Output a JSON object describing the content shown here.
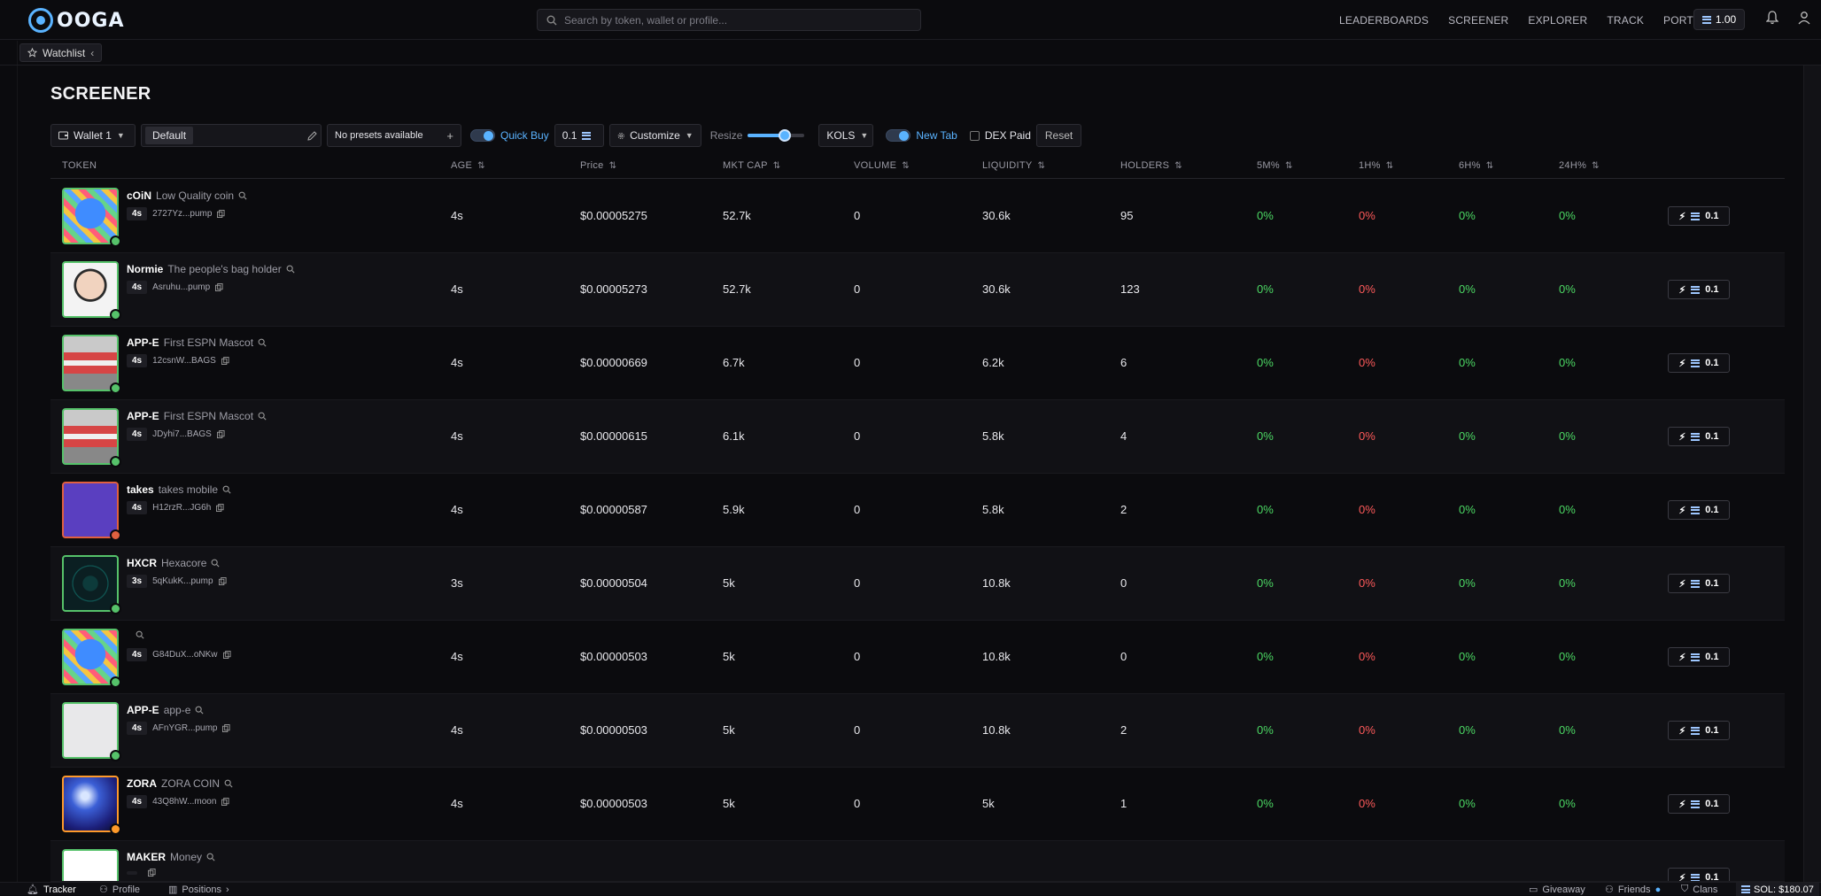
{
  "header": {
    "logo_text": "OOGA",
    "search_placeholder": "Search by token, wallet or profile...",
    "nav": [
      "LEADERBOARDS",
      "SCREENER",
      "EXPLORER",
      "TRACK",
      "PORTFOLIO"
    ],
    "balance": "1.00"
  },
  "watchlist": {
    "label": "Watchlist"
  },
  "page": {
    "title": "SCREENER"
  },
  "toolbar": {
    "wallet": "Wallet 1",
    "preset": "Default",
    "no_presets": "No presets available",
    "quick_buy_label": "Quick Buy",
    "quick_buy_amount": "0.1",
    "customize": "Customize",
    "resize": "Resize",
    "resize_level": 0.65,
    "kols": "KOLS",
    "new_tab": "New Tab",
    "dex_paid": "DEX Paid",
    "reset": "Reset"
  },
  "columns": {
    "token": "TOKEN",
    "age": "AGE",
    "price": "Price",
    "mktcap": "MKT CAP",
    "volume": "VOLUME",
    "liquidity": "LIQUIDITY",
    "holders": "HOLDERS",
    "m5": "5M%",
    "h1": "1H%",
    "h6": "6H%",
    "h24": "24H%"
  },
  "rows": [
    {
      "symbol": "cOiN",
      "name": "Low Quality coin",
      "age_chip": "4s",
      "address": "2727Yz...pump",
      "age": "4s",
      "price": "$0.00005275",
      "mktcap": "52.7k",
      "volume": "0",
      "liquidity": "30.6k",
      "holders": "95",
      "m5": "0%",
      "h1": "0%",
      "h6": "0%",
      "h24": "0%",
      "qb": "0.1"
    },
    {
      "symbol": "Normie",
      "name": "The people's bag holder",
      "age_chip": "4s",
      "address": "Asruhu...pump",
      "age": "4s",
      "price": "$0.00005273",
      "mktcap": "52.7k",
      "volume": "0",
      "liquidity": "30.6k",
      "holders": "123",
      "m5": "0%",
      "h1": "0%",
      "h6": "0%",
      "h24": "0%",
      "qb": "0.1"
    },
    {
      "symbol": "APP-E",
      "name": "First ESPN Mascot",
      "age_chip": "4s",
      "address": "12csnW...BAGS",
      "age": "4s",
      "price": "$0.00000669",
      "mktcap": "6.7k",
      "volume": "0",
      "liquidity": "6.2k",
      "holders": "6",
      "m5": "0%",
      "h1": "0%",
      "h6": "0%",
      "h24": "0%",
      "qb": "0.1"
    },
    {
      "symbol": "APP-E",
      "name": "First ESPN Mascot",
      "age_chip": "4s",
      "address": "JDyhi7...BAGS",
      "age": "4s",
      "price": "$0.00000615",
      "mktcap": "6.1k",
      "volume": "0",
      "liquidity": "5.8k",
      "holders": "4",
      "m5": "0%",
      "h1": "0%",
      "h6": "0%",
      "h24": "0%",
      "qb": "0.1"
    },
    {
      "symbol": "takes",
      "name": "takes mobile",
      "age_chip": "4s",
      "address": "H12rzR...JG6h",
      "age": "4s",
      "price": "$0.00000587",
      "mktcap": "5.9k",
      "volume": "0",
      "liquidity": "5.8k",
      "holders": "2",
      "m5": "0%",
      "h1": "0%",
      "h6": "0%",
      "h24": "0%",
      "qb": "0.1"
    },
    {
      "symbol": "HXCR",
      "name": "Hexacore",
      "age_chip": "3s",
      "address": "5qKukK...pump",
      "age": "3s",
      "price": "$0.00000504",
      "mktcap": "5k",
      "volume": "0",
      "liquidity": "10.8k",
      "holders": "0",
      "m5": "0%",
      "h1": "0%",
      "h6": "0%",
      "h24": "0%",
      "qb": "0.1"
    },
    {
      "symbol": "",
      "name": "",
      "age_chip": "4s",
      "address": "G84DuX...oNKw",
      "age": "4s",
      "price": "$0.00000503",
      "mktcap": "5k",
      "volume": "0",
      "liquidity": "10.8k",
      "holders": "0",
      "m5": "0%",
      "h1": "0%",
      "h6": "0%",
      "h24": "0%",
      "qb": "0.1"
    },
    {
      "symbol": "APP-E",
      "name": "app-e",
      "age_chip": "4s",
      "address": "AFnYGR...pump",
      "age": "4s",
      "price": "$0.00000503",
      "mktcap": "5k",
      "volume": "0",
      "liquidity": "10.8k",
      "holders": "2",
      "m5": "0%",
      "h1": "0%",
      "h6": "0%",
      "h24": "0%",
      "qb": "0.1"
    },
    {
      "symbol": "ZORA",
      "name": "ZORA COIN",
      "age_chip": "4s",
      "address": "43Q8hW...moon",
      "age": "4s",
      "price": "$0.00000503",
      "mktcap": "5k",
      "volume": "0",
      "liquidity": "5k",
      "holders": "1",
      "m5": "0%",
      "h1": "0%",
      "h6": "0%",
      "h24": "0%",
      "qb": "0.1"
    },
    {
      "symbol": "MAKER",
      "name": "Money",
      "age_chip": "",
      "address": "",
      "age": "",
      "price": "",
      "mktcap": "",
      "volume": "",
      "liquidity": "",
      "holders": "",
      "m5": "",
      "h1": "",
      "h6": "",
      "h24": "",
      "qb": "0.1"
    }
  ],
  "footer": {
    "tracker": "Tracker",
    "profile": "Profile",
    "positions": "Positions",
    "giveaway": "Giveaway",
    "friends": "Friends",
    "clans": "Clans",
    "sol_price": "SOL: $180.07"
  },
  "colors": {
    "accent": "#5ab3ff",
    "positive": "#4cd964",
    "negative": "#ff5a5a",
    "background": "#0b0b0e"
  }
}
